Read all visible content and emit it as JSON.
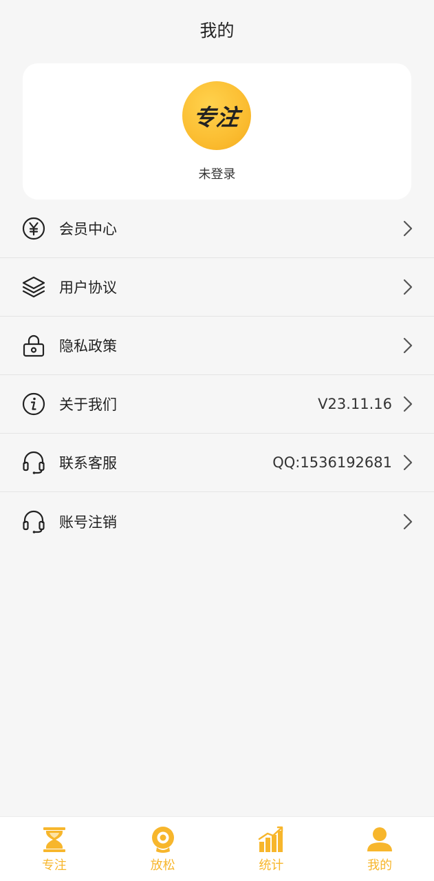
{
  "header": {
    "title": "我的"
  },
  "profile": {
    "avatar_text": "专注",
    "login_status": "未登录"
  },
  "menu": [
    {
      "label": "会员中心",
      "value": "",
      "icon": "yen-circle-icon"
    },
    {
      "label": "用户协议",
      "value": "",
      "icon": "layers-icon"
    },
    {
      "label": "隐私政策",
      "value": "",
      "icon": "lock-icon"
    },
    {
      "label": "关于我们",
      "value": "V23.11.16",
      "icon": "info-circle-icon"
    },
    {
      "label": "联系客服",
      "value": "QQ:1536192681",
      "icon": "headset-icon"
    },
    {
      "label": "账号注销",
      "value": "",
      "icon": "headset-icon"
    }
  ],
  "tabbar": [
    {
      "label": "专注",
      "icon": "hourglass-icon"
    },
    {
      "label": "放松",
      "icon": "webcam-icon"
    },
    {
      "label": "统计",
      "icon": "bar-chart-icon"
    },
    {
      "label": "我的",
      "icon": "user-icon"
    }
  ],
  "colors": {
    "accent": "#f7b62c",
    "background": "#f6f6f6",
    "card": "#ffffff",
    "divider": "#e4e4e4"
  }
}
